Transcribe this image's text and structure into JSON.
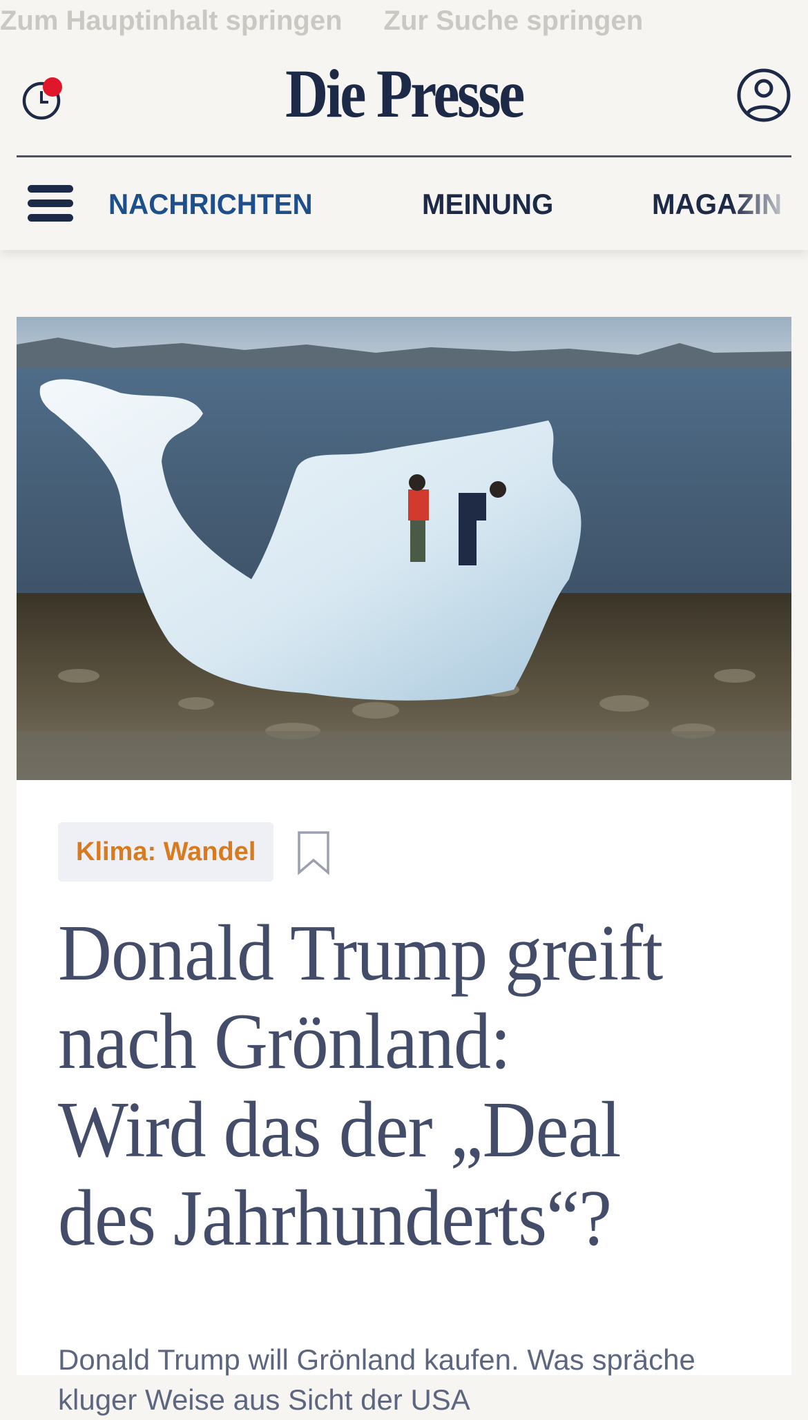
{
  "skip_links": [
    "Zum Hauptinhalt springen",
    "Zur Suche springen"
  ],
  "header": {
    "logo": "Die Presse",
    "history_icon": "clock-icon",
    "notification_dot_color": "#e0162b",
    "account_icon": "user-icon"
  },
  "nav": {
    "menu_icon": "hamburger-icon",
    "items": [
      {
        "label": "NACHRICHTEN",
        "active": true
      },
      {
        "label": "MEINUNG",
        "active": false
      },
      {
        "label": "MAGAZIN",
        "active": false
      }
    ]
  },
  "article": {
    "image_alt": "Kinder spielen auf einem Eisberg am Strand in Grönland",
    "tag": "Klima: Wandel",
    "bookmark_icon": "bookmark-icon",
    "headline_lines": [
      "Donald Trump greift",
      "nach Grönland:",
      "Wird das der „Deal",
      "des Jahrhunderts“?"
    ],
    "lead": "Donald Trump will Grönland kaufen. Was spräche kluger Weise aus Sicht der USA"
  },
  "colors": {
    "brand": "#1c2a47",
    "nav_active": "#1e4f8a",
    "tag": "#d97a1f",
    "headline": "#434d6a"
  }
}
